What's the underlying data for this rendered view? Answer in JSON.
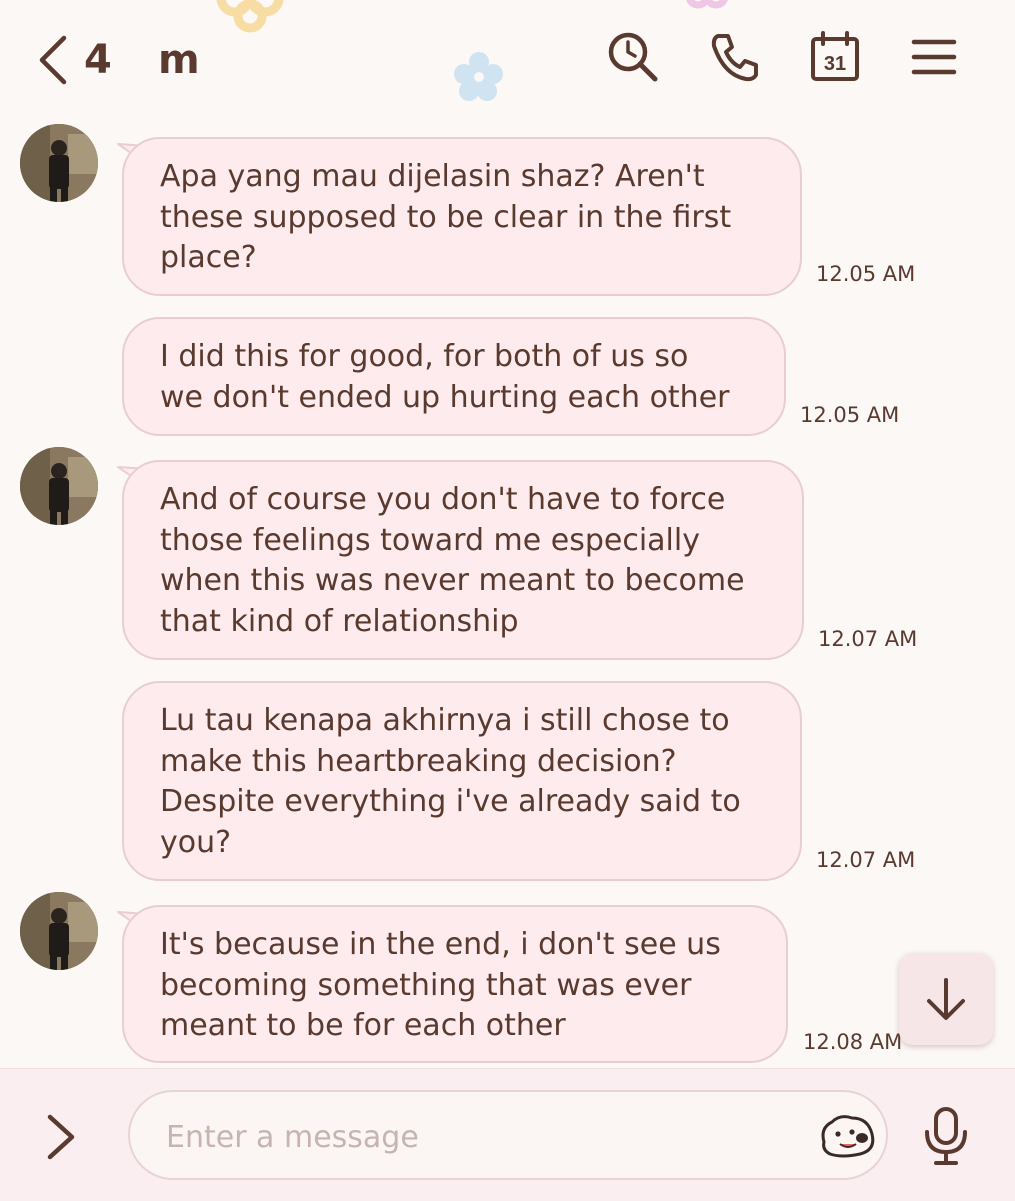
{
  "header": {
    "unread_count": "4",
    "chat_name": "m",
    "icons": [
      "back-chevron-icon",
      "search-icon",
      "phone-icon",
      "calendar-icon",
      "menu-icon"
    ],
    "calendar_day": "31"
  },
  "messages": [
    {
      "text": "Apa yang mau dijelasin shaz? Aren't\nthese supposed to be clear in the first\nplace?",
      "time": "12.05 AM",
      "has_avatar": true
    },
    {
      "text": "I did this for good, for both of us so\nwe don't ended up hurting each other",
      "time": "12.05 AM",
      "has_avatar": false
    },
    {
      "text": "And of course you don't have to force\nthose feelings toward me especially\nwhen this was never meant to become\nthat kind of relationship",
      "time": "12.07 AM",
      "has_avatar": true
    },
    {
      "text": "Lu tau kenapa akhirnya i still chose to\nmake this heartbreaking decision?\nDespite everything i've already said to\nyou?",
      "time": "12.07 AM",
      "has_avatar": false
    },
    {
      "text": "It's because in the end, i don't see us\nbecoming something that was ever\nmeant to be for each other",
      "time": "12.08 AM",
      "has_avatar": true
    }
  ],
  "input": {
    "placeholder": "Enter a message",
    "value": ""
  },
  "colors": {
    "text": "#5a3a2e",
    "bubble": "#fdebed",
    "bubble_border": "#e9cdd2",
    "background": "#fbf8f6",
    "input_bar": "#fbeef0"
  }
}
